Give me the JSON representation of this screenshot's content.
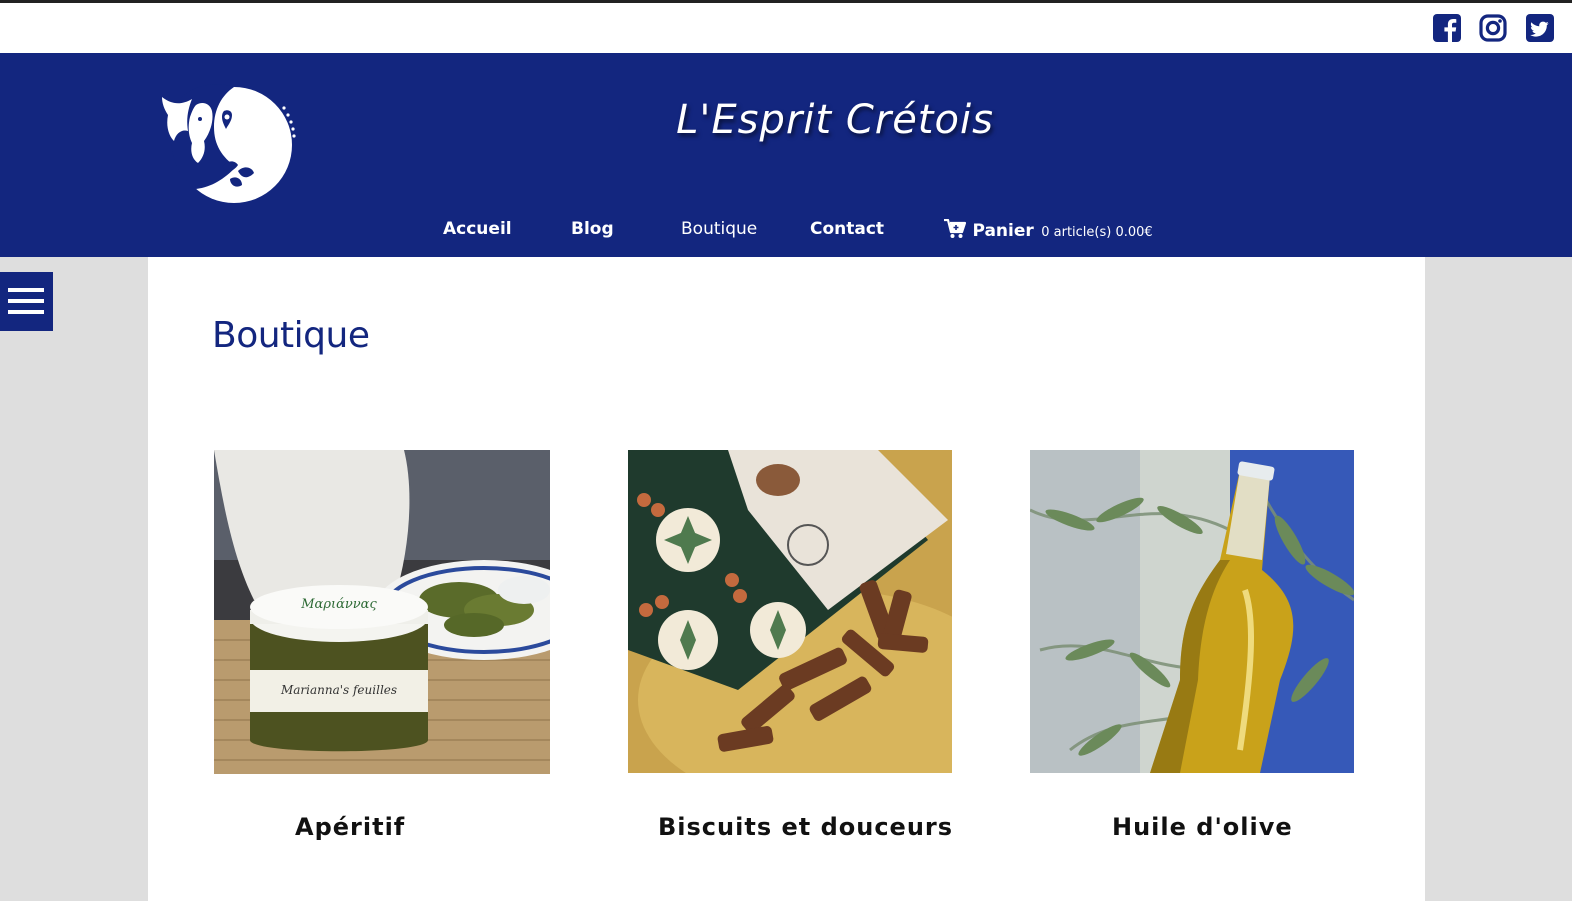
{
  "site": {
    "title": "L'Esprit Crétois",
    "logo_icon": "minoan-woman-bull-logo"
  },
  "social": {
    "icons": [
      "facebook-icon",
      "instagram-icon",
      "twitter-icon"
    ],
    "color": "#13267f"
  },
  "nav": {
    "items": [
      {
        "label": "Accueil"
      },
      {
        "label": "Blog"
      },
      {
        "label": "Boutique"
      },
      {
        "label": "Contact"
      }
    ],
    "cart": {
      "label": "Panier",
      "info": "0 article(s) 0.00€"
    }
  },
  "page": {
    "title": "Boutique"
  },
  "products": [
    {
      "name": "Apéritif",
      "image": "jar of stuffed vine leaves"
    },
    {
      "name": "Biscuits et douceurs",
      "image": "wine sweet cookies box"
    },
    {
      "name": "Huile d'olive",
      "image": "olive oil bottle among olive branches"
    }
  ],
  "colors": {
    "brand_blue": "#13267f",
    "background": "#dedede",
    "content": "#ffffff"
  }
}
